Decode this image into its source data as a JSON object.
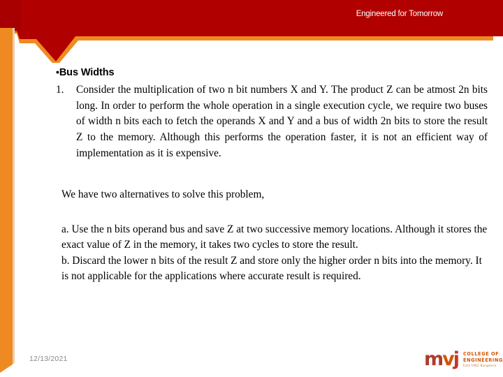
{
  "header": {
    "tagline": "Engineered for Tomorrow",
    "banner_color": "#b00000",
    "accent_color": "#ef8a22"
  },
  "content": {
    "title": "Bus Widths",
    "bullet_glyph": "•",
    "numbered_items": [
      "Consider the multiplication of two n bit numbers X and Y. The product Z can be atmost 2n bits long. In order to perform the whole operation in a single execution cycle, we require two buses of width n bits each to fetch the operands X and Y and a bus of width 2n bits to store the result Z to the memory. Although this performs the operation faster, it is not an efficient way of implementation as it is expensive."
    ],
    "intro_paragraph": "We have two alternatives to solve this problem,",
    "alternatives": [
      "a. Use the n bits operand bus and save Z at two successive memory locations. Although it stores the exact value of Z in the memory, it takes two cycles to store the result.",
      "b. Discard the lower n bits of the result Z and store only the higher order n bits into the memory. It is not applicable for the applications where accurate result is required."
    ]
  },
  "footer": {
    "date": "12/13/2021",
    "logo": {
      "mark_m": "m",
      "mark_v": "v",
      "mark_j": "j",
      "line1": "COLLEGE OF",
      "line2": "ENGINEERING",
      "line3": "Estd 1982 Bangalore"
    }
  }
}
